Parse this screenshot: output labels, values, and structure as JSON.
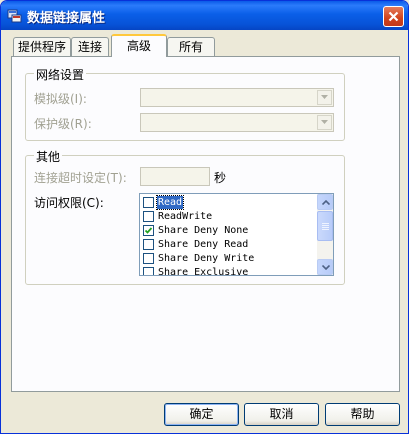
{
  "window": {
    "title": "数据链接属性",
    "title_icon": "data-link-icon",
    "close_icon": "close-icon"
  },
  "tabs": [
    {
      "label": "提供程序",
      "active": false
    },
    {
      "label": "连接",
      "active": false
    },
    {
      "label": "高级",
      "active": true
    },
    {
      "label": "所有",
      "active": false
    }
  ],
  "network_group": {
    "title": "网络设置",
    "impersonation_label": "模拟级(I):",
    "impersonation_value": "",
    "protection_label": "保护级(R):",
    "protection_value": ""
  },
  "other_group": {
    "title": "其他",
    "timeout_label": "连接超时设定(T):",
    "timeout_value": "",
    "timeout_unit": "秒",
    "access_label": "访问权限(C):",
    "access_items": [
      {
        "label": "Read",
        "checked": false,
        "selected": true
      },
      {
        "label": "ReadWrite",
        "checked": false,
        "selected": false
      },
      {
        "label": "Share Deny None",
        "checked": true,
        "selected": false
      },
      {
        "label": "Share Deny Read",
        "checked": false,
        "selected": false
      },
      {
        "label": "Share Deny Write",
        "checked": false,
        "selected": false
      },
      {
        "label": "Share Exclusive",
        "checked": false,
        "selected": false
      }
    ]
  },
  "buttons": {
    "ok": "确定",
    "cancel": "取消",
    "help": "帮助"
  },
  "colors": {
    "titlebar": "#0a5fe8",
    "dialog_bg": "#ece9d8",
    "active_tab_accent": "#ffc83c",
    "selection": "#316ac5"
  }
}
